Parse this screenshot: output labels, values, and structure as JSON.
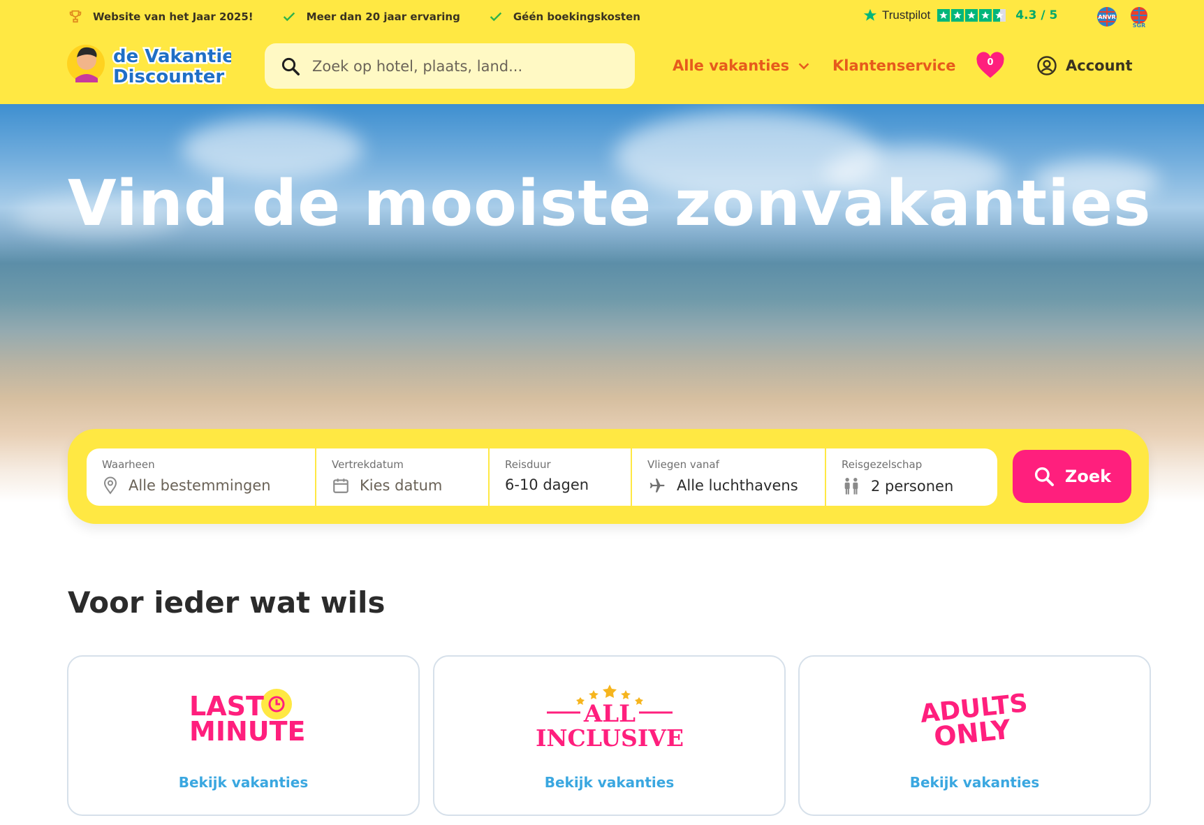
{
  "usp": [
    {
      "icon": "trophy-icon",
      "text": "Website van het Jaar 2025!"
    },
    {
      "icon": "check-icon",
      "text": "Meer dan 20 jaar ervaring"
    },
    {
      "icon": "check-icon",
      "text": "Géén boekingskosten"
    }
  ],
  "trustpilot": {
    "name": "Trustpilot",
    "score": "4.3 / 5",
    "stars": 4.5
  },
  "badges": [
    "ANVR",
    "SGR"
  ],
  "logo": {
    "line1": "de Vakantie",
    "line2": "Discounter"
  },
  "search": {
    "placeholder": "Zoek op hotel, plaats, land..."
  },
  "nav": {
    "vakanties": "Alle vakanties",
    "klantenservice": "Klantenservice",
    "favorites_count": "0",
    "account": "Account"
  },
  "hero": {
    "title": "Vind de mooiste zonvakanties"
  },
  "search_panel": {
    "fields": [
      {
        "label": "Waarheen",
        "value": "Alle bestemmingen",
        "icon": "location-pin-icon"
      },
      {
        "label": "Vertrekdatum",
        "value": "Kies datum",
        "icon": "calendar-icon"
      },
      {
        "label": "Reisduur",
        "value": "6-10 dagen"
      },
      {
        "label": "Vliegen vanaf",
        "value": "Alle luchthavens",
        "icon": "airplane-icon"
      },
      {
        "label": "Reisgezelschap",
        "value": "2 personen",
        "icon": "people-icon"
      }
    ],
    "button": "Zoek"
  },
  "section": {
    "title": "Voor ieder wat wils"
  },
  "cards": [
    {
      "logo_line1": "LAST",
      "logo_line2": "MINUTE",
      "link": "Bekijk vakanties"
    },
    {
      "logo_line1": "ALL",
      "logo_line2": "INCLUSIVE",
      "link": "Bekijk vakanties"
    },
    {
      "logo_line1": "ADULTS",
      "logo_line2": "ONLY",
      "link": "Bekijk vakanties"
    }
  ],
  "colors": {
    "brand_yellow": "#ffe843",
    "accent_pink": "#ff1f7d",
    "nav_orange": "#e65a1c",
    "link_blue": "#3aa7e0",
    "trustpilot_green": "#00b67a"
  }
}
